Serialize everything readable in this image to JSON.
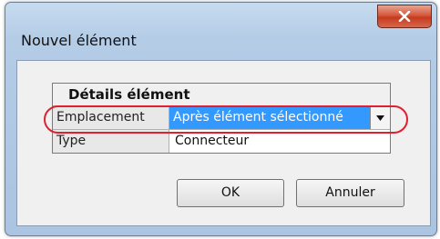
{
  "window": {
    "title": "Nouvel élément"
  },
  "grid": {
    "header": "Détails élément",
    "rows": [
      {
        "label": "Emplacement",
        "value": "Après élément sélectionné",
        "selected": true
      },
      {
        "label": "Type",
        "value": "Connecteur"
      }
    ]
  },
  "buttons": {
    "ok": "OK",
    "cancel": "Annuler"
  },
  "icons": {
    "close": "close-icon",
    "dropdown": "chevron-down-icon"
  },
  "colors": {
    "selection": "#3399ff",
    "highlight_ring": "#e02030",
    "close_button": "#c63b1e"
  }
}
